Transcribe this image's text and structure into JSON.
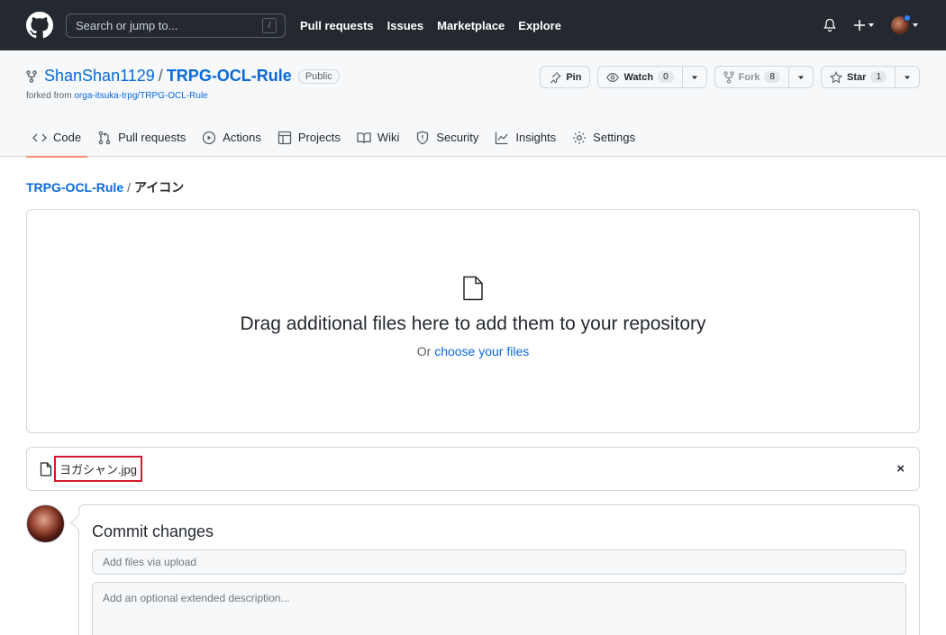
{
  "header": {
    "search_placeholder": "Search or jump to...",
    "search_key": "/",
    "nav": [
      "Pull requests",
      "Issues",
      "Marketplace",
      "Explore"
    ]
  },
  "repo": {
    "owner": "ShanShan1129",
    "separator": "/",
    "name": "TRPG-OCL-Rule",
    "visibility": "Public",
    "forked_prefix": "forked from",
    "forked_source": "orga-itsuka-trpg/TRPG-OCL-Rule",
    "actions": {
      "pin_label": "Pin",
      "watch_label": "Watch",
      "watch_count": "0",
      "fork_label": "Fork",
      "fork_count": "8",
      "star_label": "Star",
      "star_count": "1"
    },
    "tabs": [
      "Code",
      "Pull requests",
      "Actions",
      "Projects",
      "Wiki",
      "Security",
      "Insights",
      "Settings"
    ]
  },
  "breadcrumb": {
    "root": "TRPG-OCL-Rule",
    "separator": "/",
    "dir": "アイコン"
  },
  "dropzone": {
    "title": "Drag additional files here to add them to your repository",
    "sub_prefix": "Or",
    "sub_link": "choose your files"
  },
  "file": {
    "name": "ヨガシャン.jpg",
    "remove": "×"
  },
  "commit": {
    "title": "Commit changes",
    "summary_placeholder": "Add files via upload",
    "description_placeholder": "Add an optional extended description..."
  },
  "colors": {
    "header_bg": "#24292f",
    "link": "#0969da",
    "active_tab_underline": "#fd8c73",
    "highlight_box": "#d11a2a"
  }
}
